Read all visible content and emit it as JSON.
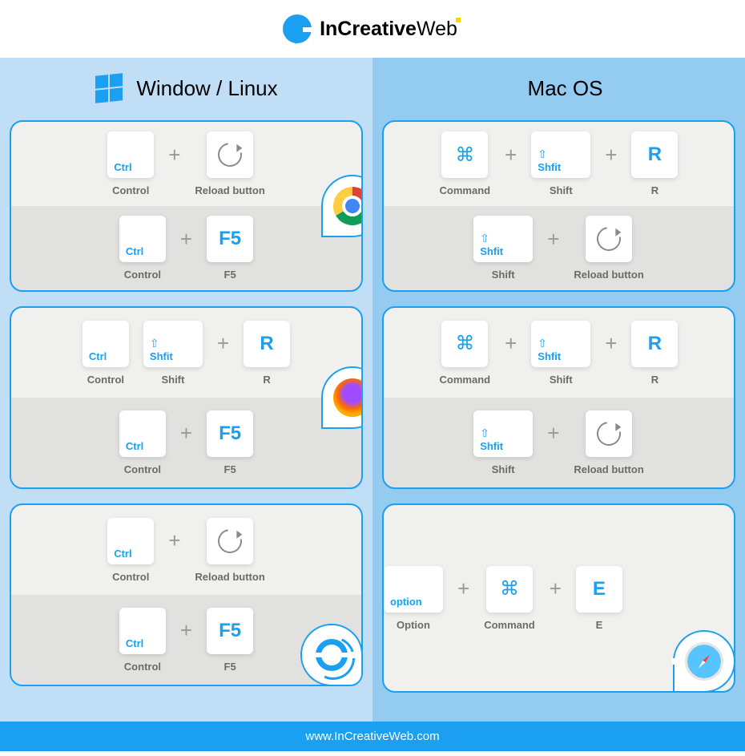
{
  "brand": {
    "part1": "InCreative",
    "part2": "Web"
  },
  "columns": {
    "left": "Window / Linux",
    "right": "Mac OS"
  },
  "labels": {
    "control": "Control",
    "reload": "Reload button",
    "f5": "F5",
    "command": "Command",
    "shift": "Shift",
    "r": "R",
    "option": "Option",
    "e": "E"
  },
  "keys": {
    "ctrl": "Ctrl",
    "f5": "F5",
    "r": "R",
    "cmd": "⌘",
    "shift_text": "Shfit",
    "option": "option",
    "e": "E"
  },
  "footer": "www.InCreativeWeb.com"
}
